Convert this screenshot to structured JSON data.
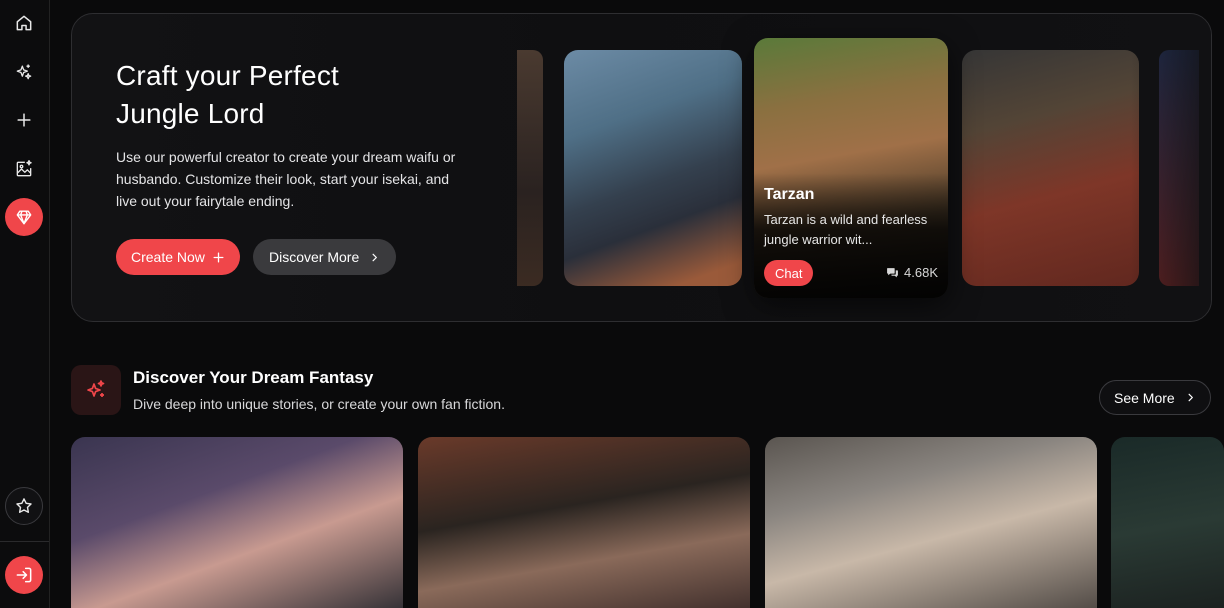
{
  "sidebar": {
    "items": [
      {
        "icon": "home-icon"
      },
      {
        "icon": "sparkles-icon"
      },
      {
        "icon": "plus-icon"
      },
      {
        "icon": "image-sparkle-icon"
      },
      {
        "icon": "diamond-icon"
      },
      {
        "icon": "star-icon"
      },
      {
        "icon": "login-icon"
      }
    ]
  },
  "hero": {
    "title": "Craft your Perfect Jungle Lord",
    "description": "Use our powerful creator to create your dream waifu or husbando. Customize their look, start your isekai, and live out your fairytale ending.",
    "create_label": "Create Now",
    "discover_label": "Discover More",
    "featured": {
      "name": "Tarzan",
      "description": "Tarzan is a wild and fearless jungle warrior wit...",
      "chat_label": "Chat",
      "chat_count": "4.68K"
    }
  },
  "section": {
    "title": "Discover Your Dream Fantasy",
    "subtitle": "Dive deep into unique stories, or create your own fan fiction.",
    "see_more_label": "See More"
  },
  "colors": {
    "accent": "#f0464a",
    "background": "#0a0a0b",
    "surface": "#3a3a3d"
  }
}
